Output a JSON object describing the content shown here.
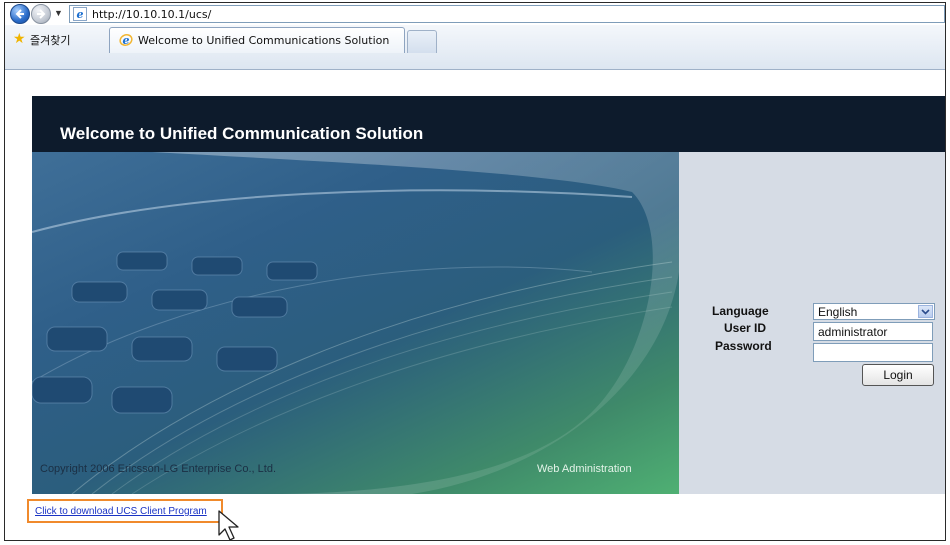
{
  "browser": {
    "url": "http://10.10.10.1/ucs/",
    "favorites_label": "즐겨찾기",
    "tab_title": "Welcome to Unified Communications Solution"
  },
  "page": {
    "title": "Welcome to Unified Communication Solution",
    "copyright": "Copyright 2006 Ericsson-LG Enterprise Co., Ltd.",
    "web_admin": "Web Administration",
    "download_link": "Click to download UCS Client Program"
  },
  "login": {
    "language_label": "Language",
    "language_value": "English",
    "userid_label": "User ID",
    "userid_value": "administrator",
    "password_label": "Password",
    "password_value": "",
    "login_button": "Login"
  },
  "colors": {
    "header_bg": "#0d1b2c",
    "login_panel_bg": "#d6dce5",
    "highlight_border": "#f08a2c",
    "link": "#1a33c4"
  },
  "icons": [
    "back-arrow-icon",
    "forward-arrow-icon",
    "ie-icon",
    "star-icon",
    "dropdown-arrow-icon",
    "mouse-cursor-icon"
  ]
}
